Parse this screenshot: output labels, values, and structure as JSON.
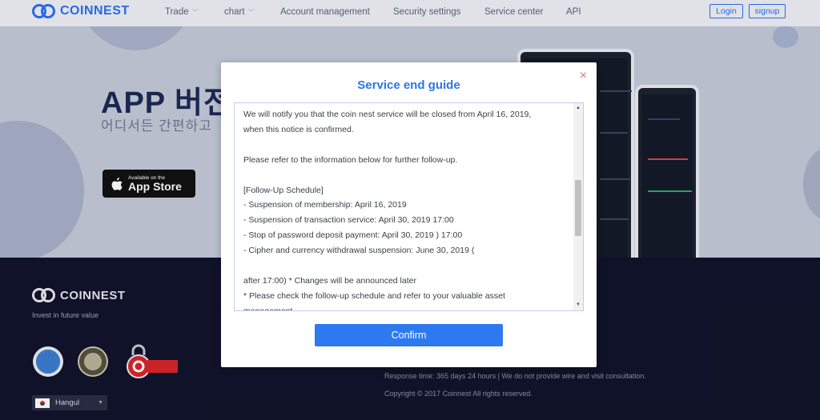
{
  "brand": {
    "name": "COINNEST"
  },
  "nav": {
    "items": [
      {
        "label": "Trade",
        "dropdown": true
      },
      {
        "label": "chart",
        "dropdown": true
      },
      {
        "label": "Account management",
        "dropdown": false
      },
      {
        "label": "Security settings",
        "dropdown": false
      },
      {
        "label": "Service center",
        "dropdown": false
      },
      {
        "label": "API",
        "dropdown": false
      }
    ],
    "login_label": "Login",
    "signup_label": "signup"
  },
  "hero": {
    "title": "APP 버전",
    "subtitle": "어디서든 간편하고",
    "appstore_small": "Available on the",
    "appstore_big": "App Store"
  },
  "footer": {
    "brand": "COINNEST",
    "tagline": "Invest in future value",
    "comodo_label": "COMODO SECURE",
    "language": "Hangul",
    "response_time": "Response time: 365 days 24 hours | We do not provide wire and visit consultation.",
    "copyright": "Copyright © 2017 Coinnest All rights reserved."
  },
  "modal": {
    "title": "Service end guide",
    "close_icon": "×",
    "lines": [
      "We will notify you that the coin nest service will be closed from April 16, 2019,",
      "when this notice is confirmed.",
      "",
      "Please refer to the information below for further follow-up.",
      "",
      "[Follow-Up Schedule]",
      "- Suspension of membership: April 16, 2019",
      "- Suspension of transaction service: April 30, 2019 17:00",
      "- Stop of password deposit payment: April 30, 2019 ) 17:00",
      "- Cipher and currency withdrawal suspension: June 30, 2019 (",
      "",
      "after 17:00) * Changes will be announced later",
      "* Please check the follow-up schedule and refer to your valuable asset",
      "management."
    ],
    "confirm_label": "Confirm"
  },
  "colors": {
    "accent": "#2d7af0",
    "footer_bg": "#12142c",
    "close": "#e87a6a"
  }
}
